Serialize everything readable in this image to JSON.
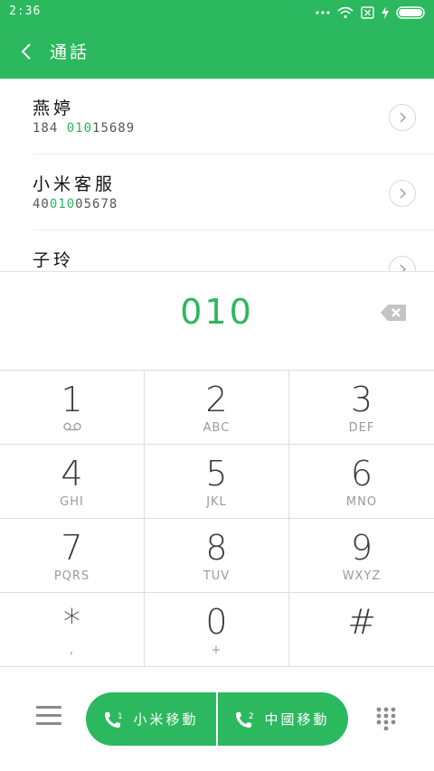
{
  "status": {
    "time": "2:36"
  },
  "header": {
    "title": "通話"
  },
  "results": [
    {
      "name": "燕婷",
      "number_parts": [
        {
          "t": "184 ",
          "hl": false
        },
        {
          "t": "010",
          "hl": true
        },
        {
          "t": "15689",
          "hl": false
        }
      ]
    },
    {
      "name": "小米客服",
      "number_parts": [
        {
          "t": "40",
          "hl": false
        },
        {
          "t": "010",
          "hl": true
        },
        {
          "t": "05678",
          "hl": false
        }
      ]
    },
    {
      "name": "子玲",
      "number_parts": []
    }
  ],
  "dialed_number": "010",
  "keys": [
    {
      "digit": "1",
      "letters": ""
    },
    {
      "digit": "2",
      "letters": "ABC"
    },
    {
      "digit": "3",
      "letters": "DEF"
    },
    {
      "digit": "4",
      "letters": "GHI"
    },
    {
      "digit": "5",
      "letters": "JKL"
    },
    {
      "digit": "6",
      "letters": "MNO"
    },
    {
      "digit": "7",
      "letters": "PQRS"
    },
    {
      "digit": "8",
      "letters": "TUV"
    },
    {
      "digit": "9",
      "letters": "WXYZ"
    },
    {
      "digit": "*",
      "letters": ","
    },
    {
      "digit": "0",
      "letters": "+"
    },
    {
      "digit": "#",
      "letters": ""
    }
  ],
  "call_buttons": {
    "sim1_label": "小米移動",
    "sim1_badge": "1",
    "sim2_label": "中國移動",
    "sim2_badge": "2"
  },
  "icons": {
    "back": "chevron-left-icon",
    "detail": "chevron-right-icon",
    "backspace": "backspace-icon",
    "voicemail": "voicemail-icon",
    "menu": "menu-icon",
    "dialpad": "dialpad-icon",
    "phone": "phone-icon"
  },
  "colors": {
    "accent": "#2bb85e",
    "divider": "#dedede"
  }
}
